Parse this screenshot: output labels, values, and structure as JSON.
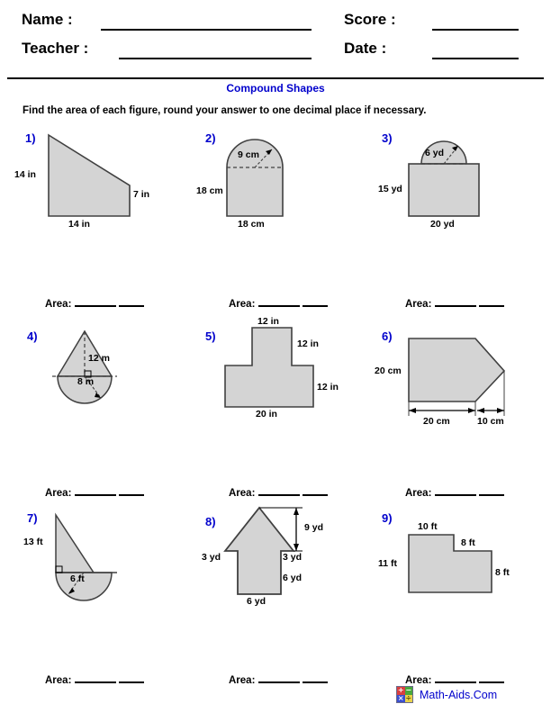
{
  "header": {
    "name_label": "Name :",
    "teacher_label": "Teacher :",
    "score_label": "Score :",
    "date_label": "Date :",
    "name_value": "",
    "teacher_value": "",
    "score_value": "",
    "date_value": ""
  },
  "title": "Compound Shapes",
  "directions": "Find the area of each figure, round your answer to one decimal place if necessary.",
  "answer_label": "Area:",
  "colors": {
    "shape_fill": "#d4d4d4",
    "shape_stroke": "#404040",
    "accent_blue": "#0000cc",
    "text": "#000000"
  },
  "problems": [
    {
      "number": "1)",
      "shape": "right-trapezoid",
      "dims": [
        {
          "label": "14 in",
          "side": "left"
        },
        {
          "label": "7 in",
          "side": "right"
        },
        {
          "label": "14 in",
          "side": "bottom"
        }
      ]
    },
    {
      "number": "2)",
      "shape": "rectangle-with-semicircle-top",
      "dims": [
        {
          "label": "9 cm",
          "side": "radius"
        },
        {
          "label": "18 cm",
          "side": "left"
        },
        {
          "label": "18 cm",
          "side": "bottom"
        }
      ]
    },
    {
      "number": "3)",
      "shape": "rectangle-with-semicircle-top",
      "dims": [
        {
          "label": "6 yd",
          "side": "radius"
        },
        {
          "label": "15 yd",
          "side": "left"
        },
        {
          "label": "20 yd",
          "side": "bottom"
        }
      ]
    },
    {
      "number": "4)",
      "shape": "triangle-on-semicircle",
      "dims": [
        {
          "label": "12 m",
          "side": "height"
        },
        {
          "label": "8 m",
          "side": "radius"
        }
      ]
    },
    {
      "number": "5)",
      "shape": "t-shape",
      "dims": [
        {
          "label": "12 in",
          "side": "top"
        },
        {
          "label": "12 in",
          "side": "upper-right"
        },
        {
          "label": "12 in",
          "side": "lower-right"
        },
        {
          "label": "20 in",
          "side": "bottom"
        }
      ]
    },
    {
      "number": "6)",
      "shape": "pentagon-arrow-right",
      "dims": [
        {
          "label": "20 cm",
          "side": "left"
        },
        {
          "label": "20 cm",
          "side": "bottom-left-span"
        },
        {
          "label": "10 cm",
          "side": "bottom-right-span"
        }
      ]
    },
    {
      "number": "7)",
      "shape": "triangle-on-semicircle-offset",
      "dims": [
        {
          "label": "13 ft",
          "side": "left"
        },
        {
          "label": "6 ft",
          "side": "radius"
        }
      ]
    },
    {
      "number": "8)",
      "shape": "arrow-up",
      "dims": [
        {
          "label": "9 yd",
          "side": "right-height"
        },
        {
          "label": "3 yd",
          "side": "left-flange"
        },
        {
          "label": "3 yd",
          "side": "right-flange"
        },
        {
          "label": "6 yd",
          "side": "stem-right"
        },
        {
          "label": "6 yd",
          "side": "bottom"
        }
      ]
    },
    {
      "number": "9)",
      "shape": "l-shape",
      "dims": [
        {
          "label": "10 ft",
          "side": "top"
        },
        {
          "label": "8 ft",
          "side": "step-top"
        },
        {
          "label": "11 ft",
          "side": "left"
        },
        {
          "label": "8 ft",
          "side": "right"
        }
      ]
    }
  ],
  "footer": {
    "site": "Math-Aids.Com",
    "logo_symbols": [
      "+",
      "−",
      "×",
      "÷"
    ]
  }
}
